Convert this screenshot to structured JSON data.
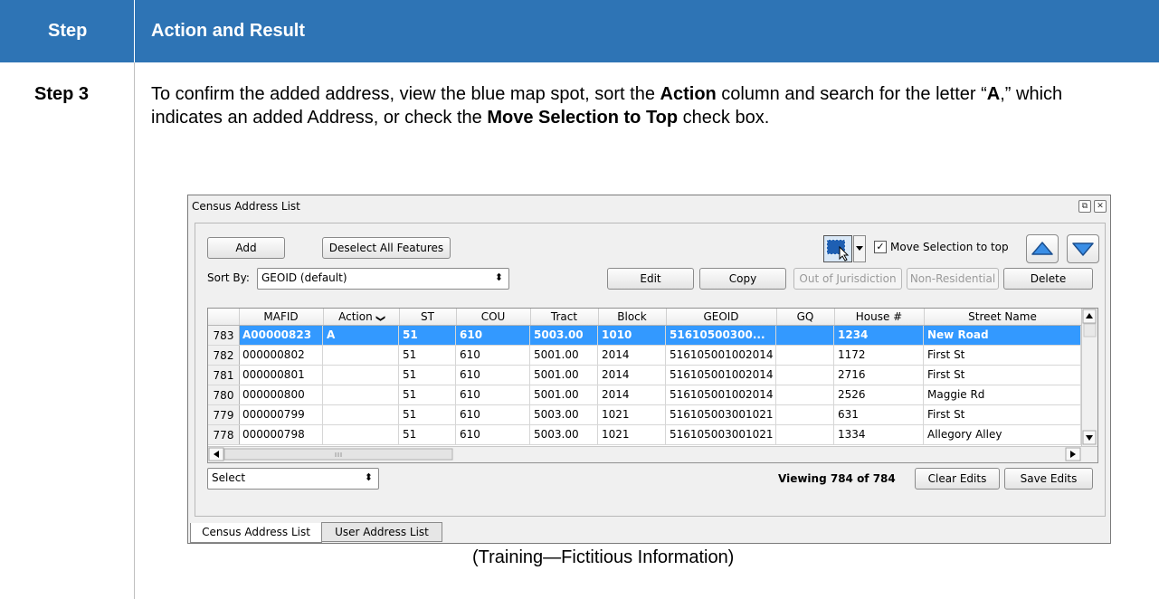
{
  "header": {
    "step_col": "Step",
    "action_col": "Action and Result"
  },
  "step": {
    "label": "Step 3",
    "text_1": "To confirm the added address, view the blue map spot, sort the ",
    "bold_1": "Action",
    "text_2": " column and search for the letter “",
    "bold_2": "A",
    "text_3": ",” which indicates an added Address, or check the ",
    "bold_3": "Move Selection to Top",
    "text_4": " check box."
  },
  "window": {
    "title": "Census Address List",
    "restore_glyph": "⧉",
    "close_glyph": "✕",
    "add_label": "Add",
    "deselect_label": "Deselect All Features",
    "move_selection_checked_glyph": "✓",
    "move_selection_label": "Move Selection to top",
    "sort_by_label": "Sort By:",
    "sort_by_value": "GEOID (default)",
    "combo_arrow": "⬍",
    "edit_label": "Edit",
    "copy_label": "Copy",
    "out_of_jurisdiction_label": "Out of Jurisdiction",
    "non_residential_label": "Non-Residential",
    "delete_label": "Delete",
    "select_value": "Select",
    "viewing_text": "Viewing 784 of 784",
    "clear_edits_label": "Clear Edits",
    "save_edits_label": "Save Edits",
    "tabs": [
      "Census Address List",
      "User Address List"
    ]
  },
  "table": {
    "columns": [
      "MAFID",
      "Action",
      "ST",
      "COU",
      "Tract",
      "Block",
      "GEOID",
      "GQ",
      "House #",
      "Street Name"
    ],
    "sort_indicator": "❯",
    "rows": [
      {
        "num": "783",
        "cells": [
          "A00000823",
          "A",
          "51",
          "610",
          "5003.00",
          "1010",
          "51610500300...",
          "",
          "1234",
          "New Road"
        ]
      },
      {
        "num": "782",
        "cells": [
          "000000802",
          "",
          "51",
          "610",
          "5001.00",
          "2014",
          "516105001002014",
          "",
          "1172",
          "First St"
        ]
      },
      {
        "num": "781",
        "cells": [
          "000000801",
          "",
          "51",
          "610",
          "5001.00",
          "2014",
          "516105001002014",
          "",
          "2716",
          "First St"
        ]
      },
      {
        "num": "780",
        "cells": [
          "000000800",
          "",
          "51",
          "610",
          "5001.00",
          "2014",
          "516105001002014",
          "",
          "2526",
          "Maggie Rd"
        ]
      },
      {
        "num": "779",
        "cells": [
          "000000799",
          "",
          "51",
          "610",
          "5003.00",
          "1021",
          "516105003001021",
          "",
          "631",
          "First St"
        ]
      },
      {
        "num": "778",
        "cells": [
          "000000798",
          "",
          "51",
          "610",
          "5003.00",
          "1021",
          "516105003001021",
          "",
          "1334",
          "Allegory Alley"
        ]
      }
    ]
  },
  "caption": "(Training—Fictitious Information)",
  "colors": {
    "header_bg": "#2e74b5",
    "selected_row": "#3399ff"
  }
}
